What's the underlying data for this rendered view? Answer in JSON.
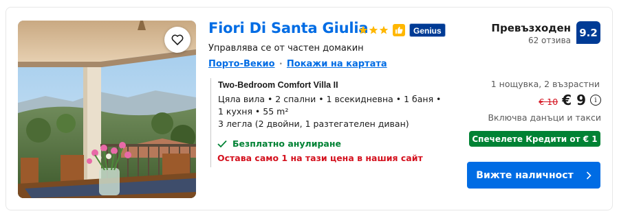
{
  "property": {
    "name": "Fiori Di Santa Giulia",
    "stars": 3,
    "genius_badge": "Genius",
    "host_note": "Управлява се от частен домакин",
    "location_link": "Порто-Векио",
    "map_link": "Покажи на картата",
    "favorite_icon": "heart-icon"
  },
  "room": {
    "name": "Two-Bedroom Comfort Villa II",
    "specs_line1": "Цяла вила • 2 спални • 1 всекидневна • 1 баня •",
    "specs_line2": "1 кухня • 55 m²",
    "beds": "3 легла (2 двойни, 1 разтегателен диван)",
    "free_cancellation": "Безплатно анулиране",
    "scarcity": "Остава само 1 на тази цена в нашия сайт"
  },
  "rating": {
    "word": "Превъзходен",
    "reviews": "62 отзива",
    "score": "9.2"
  },
  "price": {
    "stay": "1 нощувка, 2 възрастни",
    "old": "€ 10",
    "new": "€ 9",
    "info_icon": "i",
    "taxes": "Включва данъци и такси",
    "credit": "Спечелете Кредити от € 1",
    "cta": "Вижте наличност"
  },
  "colors": {
    "brand_blue": "#006ce4",
    "dark_blue": "#003b95",
    "green": "#008234",
    "red": "#d4111e",
    "star_yellow": "#ffb700"
  }
}
